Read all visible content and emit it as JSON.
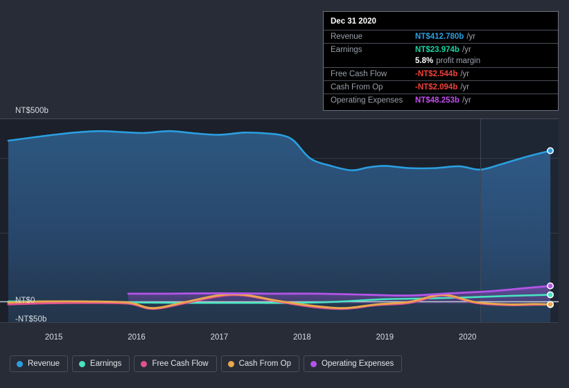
{
  "chart_data": {
    "type": "area",
    "title": "",
    "xlabel": "",
    "ylabel": "",
    "currency": "NT$",
    "xlim": [
      2014.35,
      2021.1
    ],
    "ylim": [
      -50,
      500
    ],
    "grid": true,
    "legend_position": "bottom-left",
    "y_ticks": [
      {
        "value": 500,
        "label": "NT$500b"
      },
      {
        "value": 0,
        "label": "NT$0"
      },
      {
        "value": -50,
        "label": "-NT$50b"
      }
    ],
    "x_ticks": [
      {
        "value": 2015,
        "label": "2015"
      },
      {
        "value": 2016,
        "label": "2016"
      },
      {
        "value": 2017,
        "label": "2017"
      },
      {
        "value": 2018,
        "label": "2018"
      },
      {
        "value": 2019,
        "label": "2019"
      },
      {
        "value": 2020,
        "label": "2020"
      }
    ],
    "forecast_divider_x": 2020,
    "series": [
      {
        "name": "Revenue",
        "color": "#2a9fe0",
        "filled": true,
        "x": [
          2014.45,
          2014.75,
          2015.0,
          2015.25,
          2015.55,
          2015.85,
          2016.1,
          2016.4,
          2016.7,
          2017.0,
          2017.3,
          2017.55,
          2017.75,
          2017.9,
          2018.1,
          2018.35,
          2018.6,
          2018.8,
          2019.0,
          2019.3,
          2019.6,
          2019.9,
          2020.15,
          2020.4,
          2020.7,
          2021.0
        ],
        "values": [
          440,
          449,
          456,
          462,
          466,
          463,
          461,
          466,
          460,
          456,
          462,
          460,
          455,
          440,
          392,
          372,
          360,
          368,
          372,
          366,
          366,
          371,
          362,
          376,
          396,
          413
        ]
      },
      {
        "name": "Earnings",
        "color": "#49e3c0",
        "filled": false,
        "x": [
          2014.45,
          2015.0,
          2015.6,
          2016.1,
          2016.7,
          2017.3,
          2017.9,
          2018.4,
          2019.0,
          2019.5,
          2020.0,
          2020.5,
          2021.0
        ],
        "values": [
          6,
          6,
          5,
          3,
          2,
          2,
          2,
          5,
          12,
          14,
          17,
          21,
          24
        ]
      },
      {
        "name": "Free Cash Flow",
        "color": "#e0538f",
        "filled": false,
        "x": [
          2014.45,
          2014.9,
          2015.4,
          2015.9,
          2016.2,
          2016.6,
          2017.0,
          2017.3,
          2017.7,
          2018.1,
          2018.5,
          2018.9,
          2019.3,
          2019.7,
          2020.1,
          2020.5,
          2020.8,
          2021.0
        ],
        "values": [
          -2,
          1,
          2,
          0,
          -14,
          2,
          20,
          22,
          6,
          -8,
          -14,
          -4,
          2,
          22,
          2,
          -4,
          -3,
          -2.5
        ]
      },
      {
        "name": "Cash From Op",
        "color": "#e8a84c",
        "filled": false,
        "x": [
          2014.45,
          2014.9,
          2015.4,
          2015.9,
          2016.2,
          2016.6,
          2017.0,
          2017.3,
          2017.7,
          2018.1,
          2018.5,
          2018.9,
          2019.3,
          2019.7,
          2020.1,
          2020.5,
          2020.8,
          2021.0
        ],
        "values": [
          3,
          6,
          6,
          3,
          -12,
          5,
          23,
          24,
          8,
          -5,
          -12,
          -2,
          5,
          24,
          4,
          -2,
          -1,
          -2.1
        ]
      },
      {
        "name": "Operating Expenses",
        "color": "#b355e8",
        "filled": false,
        "x": [
          2015.9,
          2016.4,
          2017.0,
          2017.6,
          2018.2,
          2018.8,
          2019.3,
          2019.8,
          2020.3,
          2020.7,
          2021.0
        ],
        "values": [
          27,
          27,
          28,
          27,
          27,
          24,
          22,
          28,
          34,
          42,
          48
        ]
      }
    ],
    "last_points": [
      {
        "name": "Revenue",
        "value": 412.78
      },
      {
        "name": "Operating Expenses",
        "value": 48.253
      },
      {
        "name": "Earnings",
        "value": 23.974
      },
      {
        "name": "Cash From Op",
        "value": -2.094
      },
      {
        "name": "Free Cash Flow",
        "value": -2.544
      }
    ]
  },
  "axis": {
    "y_top_label": "NT$500b",
    "y_zero_label": "NT$0",
    "y_bottom_label": "-NT$50b",
    "x_labels": [
      "2015",
      "2016",
      "2017",
      "2018",
      "2019",
      "2020"
    ]
  },
  "tooltip": {
    "date": "Dec 31 2020",
    "rows": [
      {
        "label": "Revenue",
        "value": "NT$412.780b",
        "unit": "/yr",
        "color": "#2a9fe0",
        "rule": true
      },
      {
        "label": "Earnings",
        "value": "NT$23.974b",
        "unit": "/yr",
        "color": "#17d6a4",
        "rule": true
      },
      {
        "label": "",
        "value": "5.8%",
        "unit": "profit margin",
        "color": "#ffffff",
        "rule": false
      },
      {
        "label": "Free Cash Flow",
        "value": "-NT$2.544b",
        "unit": "/yr",
        "color": "#f0423c",
        "rule": true
      },
      {
        "label": "Cash From Op",
        "value": "-NT$2.094b",
        "unit": "/yr",
        "color": "#f0423c",
        "rule": true
      },
      {
        "label": "Operating Expenses",
        "value": "NT$48.253b",
        "unit": "/yr",
        "color": "#c34df0",
        "rule": true
      }
    ]
  },
  "legend": {
    "items": [
      {
        "label": "Revenue",
        "color": "#2a9fe0"
      },
      {
        "label": "Earnings",
        "color": "#49e3c0"
      },
      {
        "label": "Free Cash Flow",
        "color": "#e0538f"
      },
      {
        "label": "Cash From Op",
        "color": "#e8a84c"
      },
      {
        "label": "Operating Expenses",
        "color": "#b355e8"
      }
    ]
  },
  "colors": {
    "page_background": "#282c37",
    "plot_background": "#1b202a",
    "grid": "#39404d",
    "zero_line": "#c9cfd8",
    "revenue_fill_top": "#2b5075",
    "revenue_fill_bottom": "#233449"
  }
}
